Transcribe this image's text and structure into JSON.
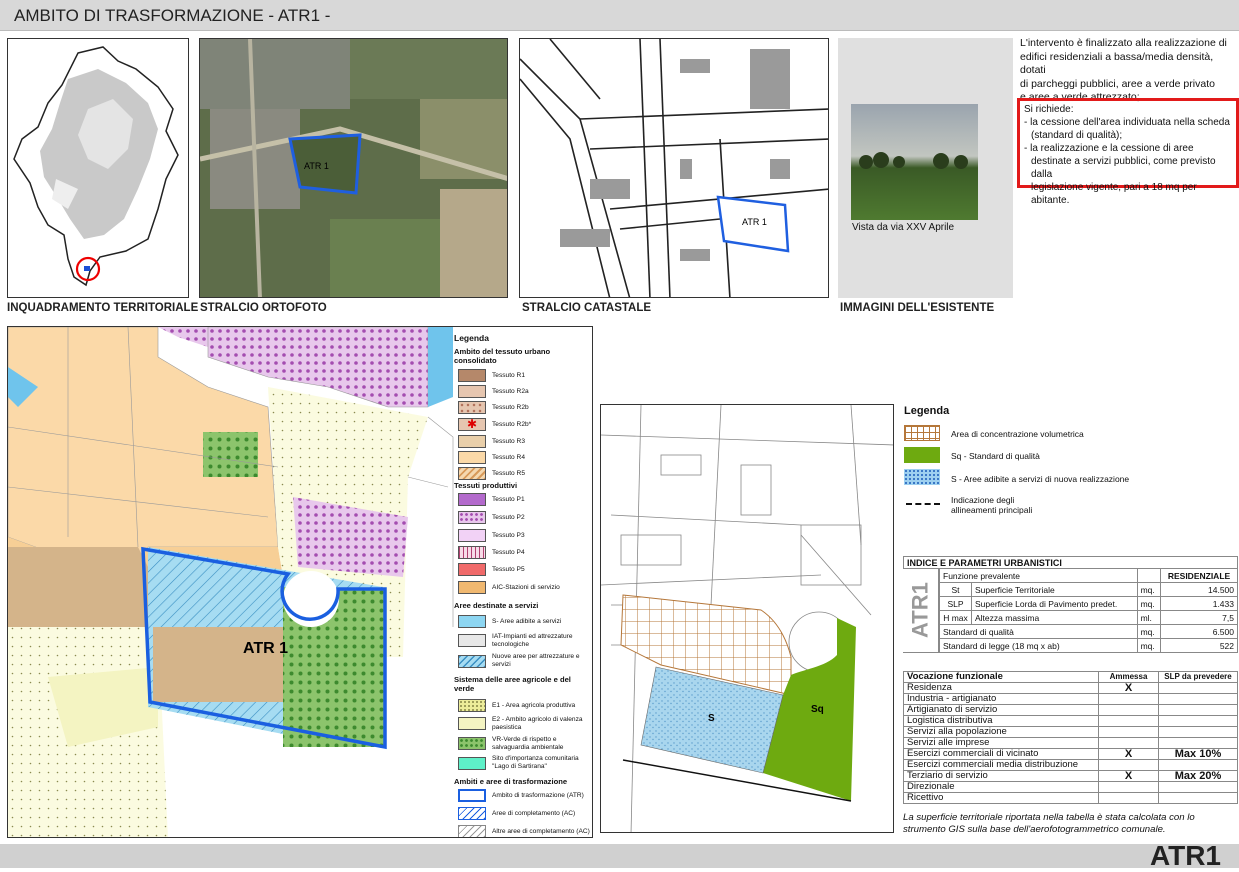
{
  "header": {
    "title": "AMBITO DI TRASFORMAZIONE - ATR1 -"
  },
  "footer": {
    "code": "ATR1"
  },
  "captions": {
    "territoriale": "INQUADRAMENTO TERRITORIALE",
    "ortofoto": "STRALCIO ORTOFOTO",
    "catastale": "STRALCIO CATASTALE",
    "esistente": "IMMAGINI DELL'ESISTENTE"
  },
  "photo_caption": "Vista da via XXV Aprile",
  "map_labels": {
    "ortho": "ATR 1",
    "cat": "ATR 1",
    "main": "ATR 1",
    "s": "S",
    "sq": "Sq"
  },
  "description": [
    "L'intervento è finalizzato alla realizzazione di",
    "edifici residenziali a bassa/media densità, dotati",
    "di parcheggi pubblici, aree a verde privato",
    "e aree a verde attrezzato;"
  ],
  "requirements": [
    "Si richiede:",
    "- la cessione dell'area individuata nella scheda",
    "  (standard di qualità);",
    "- la realizzazione e la cessione di aree",
    "  destinate a servizi pubblici, come previsto dalla",
    "  legislazione vigente, pari a 18 mq per abitante."
  ],
  "legend1": {
    "title": "Legenda",
    "g1": "Ambito del tessuto urbano consolidato",
    "r": [
      "Tessuto R1",
      "Tessuto R2a",
      "Tessuto R2b",
      "Tessuto R2b*",
      "Tessuto R3",
      "Tessuto R4",
      "Tessuto R5"
    ],
    "g2": "Tessuti produttivi",
    "p": [
      "Tessuto P1",
      "Tessuto P2",
      "Tessuto P3",
      "Tessuto P4",
      "Tessuto P5",
      "AIC-Stazioni di servizio"
    ],
    "g3": "Aree destinate a servizi",
    "s": [
      "S- Aree adibite a servizi",
      "IAT-Impianti ed attrezzature tecnologiche",
      "Nuove aree per attrezzature e servizi"
    ],
    "g4": "Sistema delle aree agricole e del verde",
    "e": [
      "E1 - Area agricola produttiva",
      "E2 - Ambito agricolo di valenza paesistica",
      "VR-Verde di rispetto e salvaguardia ambientale",
      "Sito d'importanza comunitaria \"Lago di Sartirana\""
    ],
    "g5": "Ambiti e aree di trasformazione",
    "a": [
      "Ambito di trasformazione (ATR)",
      "Aree di completamento (AC)",
      "Altre aree di completamento (AC)"
    ]
  },
  "legend2": {
    "title": "Legenda",
    "items": [
      "Area di concentrazione volumetrica",
      "Sq - Standard di qualità",
      "S -  Aree adibite a servizi di nuova realizzazione",
      "Indicazione degli allineamenti principali"
    ]
  },
  "params": {
    "title": "INDICE E PARAMETRI URBANISTICI",
    "side": "ATR1",
    "rows": [
      {
        "code": "",
        "label": "Funzione prevalente",
        "unit": "",
        "value": "RESIDENZIALE"
      },
      {
        "code": "St",
        "label": "Superficie Territoriale",
        "unit": "mq.",
        "value": "14.500"
      },
      {
        "code": "SLP",
        "label": "Superficie Lorda di Pavimento predet.",
        "unit": "mq.",
        "value": "1.433"
      },
      {
        "code": "H max",
        "label": "Altezza massima",
        "unit": "ml.",
        "value": "7,5"
      },
      {
        "code": "",
        "label": "Standard di qualità",
        "unit": "mq.",
        "value": "6.500"
      },
      {
        "code": "",
        "label": "Standard di legge (18 mq x ab)",
        "unit": "mq.",
        "value": "522"
      }
    ]
  },
  "vocazione": {
    "h1": "Vocazione funzionale",
    "h2": "Ammessa",
    "h3": "SLP da prevedere",
    "rows": [
      {
        "label": "Residenza",
        "a": "X",
        "s": ""
      },
      {
        "label": "Industria - artigianato",
        "a": "",
        "s": ""
      },
      {
        "label": "Artigianato di servizio",
        "a": "",
        "s": ""
      },
      {
        "label": "Logistica distributiva",
        "a": "",
        "s": ""
      },
      {
        "label": "Servizi alla popolazione",
        "a": "",
        "s": ""
      },
      {
        "label": "Servizi alle imprese",
        "a": "",
        "s": ""
      },
      {
        "label": "Esercizi commerciali di vicinato",
        "a": "X",
        "s": "Max 10%"
      },
      {
        "label": "Esercizi commerciali media distribuzione",
        "a": "",
        "s": ""
      },
      {
        "label": "Terziario di servizio",
        "a": "X",
        "s": "Max 20%"
      },
      {
        "label": "Direzionale",
        "a": "",
        "s": ""
      },
      {
        "label": "Ricettivo",
        "a": "",
        "s": ""
      }
    ]
  },
  "note": [
    "La superficie territoriale riportata nella tabella è stata calcolata con lo",
    "strumento GIS sulla base dell'aerofotogrammetrico comunale."
  ]
}
